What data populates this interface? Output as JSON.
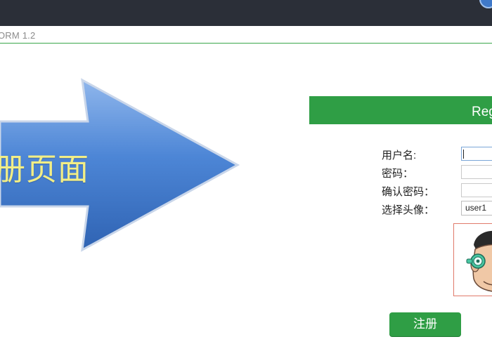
{
  "app": {
    "version_label": "ORM 1.2"
  },
  "banner": {
    "arrow_text": "册页面"
  },
  "register": {
    "title": "Reg",
    "username_label": "用户名:",
    "password_label": "密码：",
    "confirm_password_label": "确认密码：",
    "avatar_label": "选择头像：",
    "username_value": "",
    "password_value": "",
    "confirm_password_value": "",
    "avatar_selected": "user1",
    "submit_label": "注册"
  },
  "colors": {
    "top_bar": "#2b2f38",
    "accent_green": "#2f9e45",
    "arrow_blue": "#3f79c9",
    "arrow_text": "#f2ee86",
    "avatar_border": "#e07a6a"
  },
  "icons": {
    "arrow": "right-arrow-graphic",
    "avatar": "cartoon-avatar"
  }
}
